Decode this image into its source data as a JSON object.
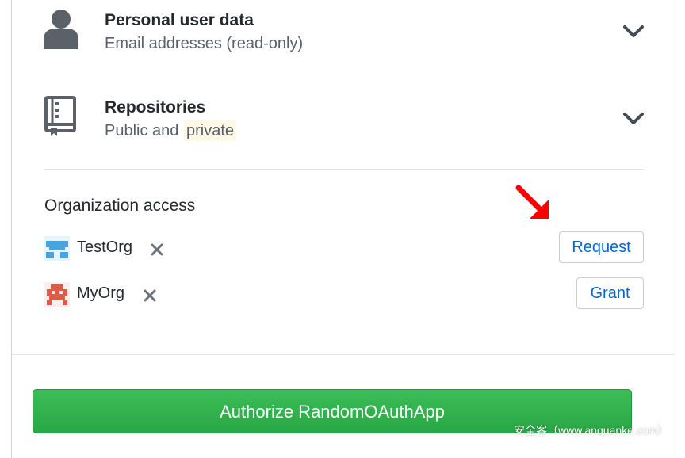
{
  "permissions": [
    {
      "title": "Personal user data",
      "subtitle_plain": "Email addresses (read-only)",
      "subtitle_highlight": "",
      "icon": "person-icon"
    },
    {
      "title": "Repositories",
      "subtitle_plain": "Public and ",
      "subtitle_highlight": "private",
      "icon": "repo-icon"
    }
  ],
  "org_access": {
    "heading": "Organization access",
    "orgs": [
      {
        "name": "TestOrg",
        "button": "Request",
        "avatar_color": "#4aa3df"
      },
      {
        "name": "MyOrg",
        "button": "Grant",
        "avatar_color": "#e05a47"
      }
    ]
  },
  "authorize": {
    "label": "Authorize RandomOAuthApp"
  },
  "watermark": "安全客（www.anquanke.com）",
  "colors": {
    "green": "#28a745",
    "link_blue": "#0366d6",
    "annotation_red": "#ff0000"
  }
}
